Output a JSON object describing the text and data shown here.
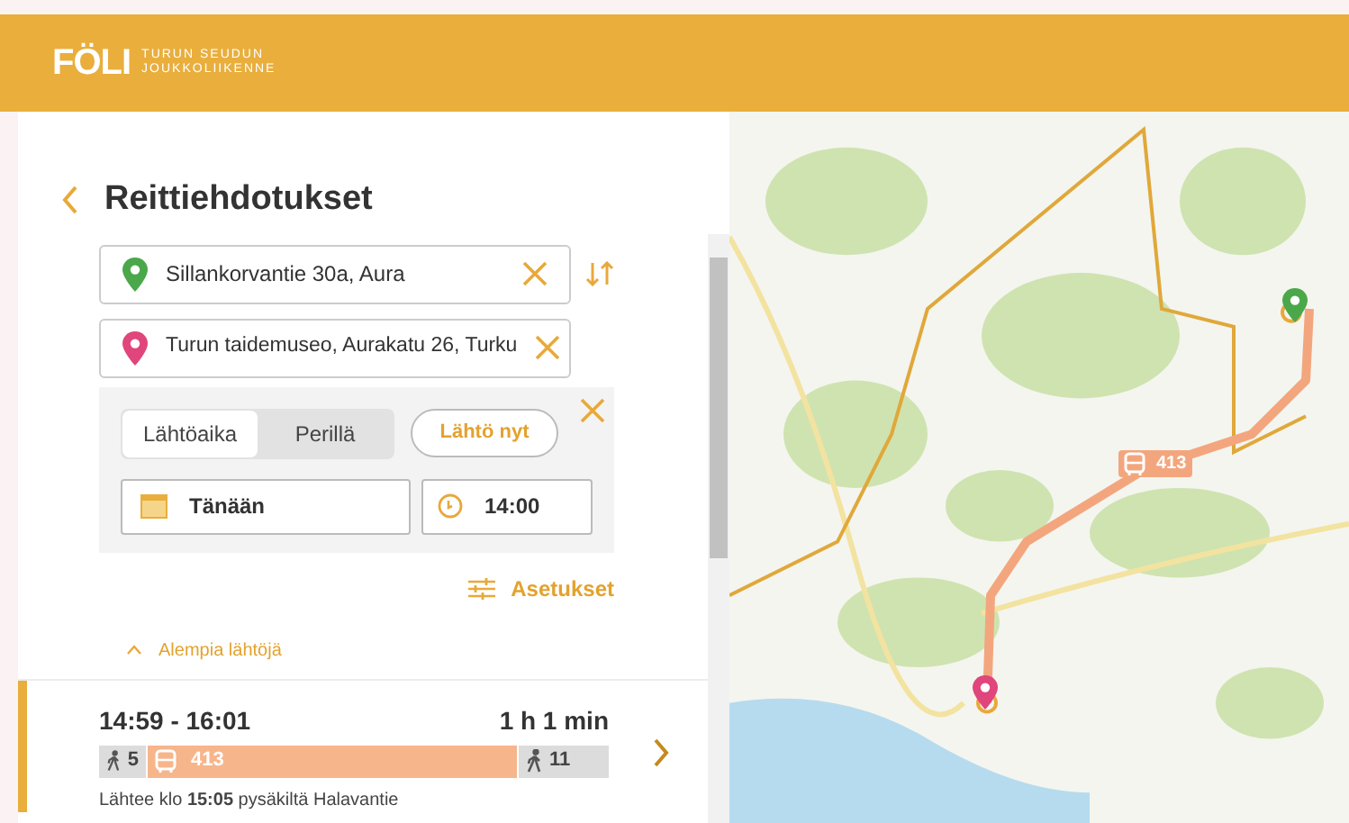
{
  "header": {
    "logo": "FÖLI",
    "tagline": [
      "TURUN SEUDUN",
      "JOUKKOLIIKENNE"
    ]
  },
  "title": "Reittiehdotukset",
  "from": {
    "value": "Sillankorvantie 30a, Aura"
  },
  "to": {
    "value": "Turun taidemuseo, Aurakatu 26, Turku"
  },
  "time_mode": [
    {
      "label": "Lähtöaika",
      "selected": true
    },
    {
      "label": "Perillä",
      "selected": false
    }
  ],
  "now_button": "Lähtö nyt",
  "date": "Tänään",
  "time": "14:00",
  "settings_link": "Asetukset",
  "earlier_link": "Alempia lähtöjä",
  "itineraries": [
    {
      "selected": true,
      "times": "14:59 - 16:01",
      "duration": "1 h 1 min",
      "legs": [
        {
          "kind": "walk",
          "label": "5"
        },
        {
          "kind": "bus",
          "label": "413"
        },
        {
          "kind": "walk",
          "label": "11"
        }
      ],
      "note": "Lähtee klo **15:05** pysäkiltä Halavantie"
    }
  ],
  "map": {
    "route_label": "413"
  }
}
